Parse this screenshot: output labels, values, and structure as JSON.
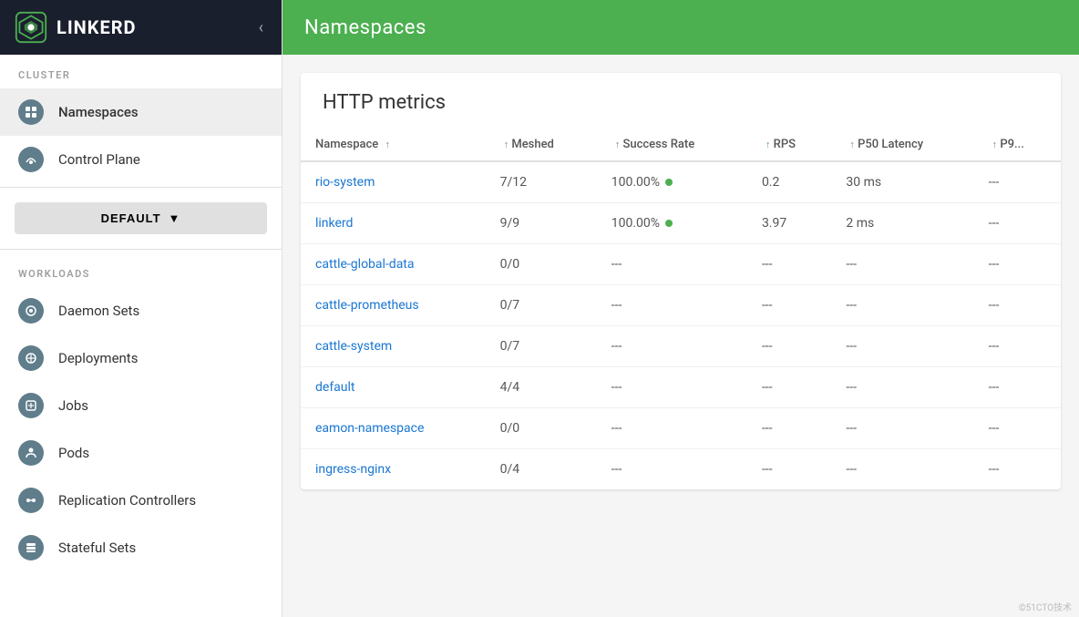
{
  "header": {
    "title": "Namespaces",
    "bg_color": "#4caf50"
  },
  "sidebar": {
    "logo_text": "LINKERD",
    "cluster_section": "CLUSTER",
    "workloads_section": "WORKLOADS",
    "default_btn": "DEFAULT",
    "items_cluster": [
      {
        "label": "Namespaces",
        "icon": "ns-icon",
        "active": true
      },
      {
        "label": "Control Plane",
        "icon": "cp-icon",
        "active": false
      }
    ],
    "items_workloads": [
      {
        "label": "Daemon Sets",
        "icon": "ds-icon"
      },
      {
        "label": "Deployments",
        "icon": "dep-icon"
      },
      {
        "label": "Jobs",
        "icon": "job-icon"
      },
      {
        "label": "Pods",
        "icon": "pod-icon"
      },
      {
        "label": "Replication Controllers",
        "icon": "rc-icon"
      },
      {
        "label": "Stateful Sets",
        "icon": "ss-icon"
      }
    ]
  },
  "table": {
    "title": "HTTP metrics",
    "columns": [
      {
        "label": "Namespace",
        "sort": true,
        "sort_active": false
      },
      {
        "label": "Meshed",
        "sort": true,
        "sort_active": false
      },
      {
        "label": "Success Rate",
        "sort": true,
        "sort_active": false
      },
      {
        "label": "RPS",
        "sort": true,
        "sort_active": true
      },
      {
        "label": "P50 Latency",
        "sort": true,
        "sort_active": false
      },
      {
        "label": "P9...",
        "sort": true,
        "sort_active": false
      }
    ],
    "rows": [
      {
        "namespace": "rio-system",
        "meshed": "7/12",
        "success_rate": "100.00%",
        "success_dot": true,
        "rps": "0.2",
        "p50": "30 ms",
        "p9x": "---"
      },
      {
        "namespace": "linkerd",
        "meshed": "9/9",
        "success_rate": "100.00%",
        "success_dot": true,
        "rps": "3.97",
        "p50": "2 ms",
        "p9x": "---"
      },
      {
        "namespace": "cattle-global-data",
        "meshed": "0/0",
        "success_rate": "---",
        "success_dot": false,
        "rps": "---",
        "p50": "---",
        "p9x": "---"
      },
      {
        "namespace": "cattle-prometheus",
        "meshed": "0/7",
        "success_rate": "---",
        "success_dot": false,
        "rps": "---",
        "p50": "---",
        "p9x": "---"
      },
      {
        "namespace": "cattle-system",
        "meshed": "0/7",
        "success_rate": "---",
        "success_dot": false,
        "rps": "---",
        "p50": "---",
        "p9x": "---"
      },
      {
        "namespace": "default",
        "meshed": "4/4",
        "success_rate": "---",
        "success_dot": false,
        "rps": "---",
        "p50": "---",
        "p9x": "---"
      },
      {
        "namespace": "eamon-namespace",
        "meshed": "0/0",
        "success_rate": "---",
        "success_dot": false,
        "rps": "---",
        "p50": "---",
        "p9x": "---"
      },
      {
        "namespace": "ingress-nginx",
        "meshed": "0/4",
        "success_rate": "---",
        "success_dot": false,
        "rps": "---",
        "p50": "---",
        "p9x": "---"
      }
    ]
  },
  "watermark": "©51CTO技术"
}
